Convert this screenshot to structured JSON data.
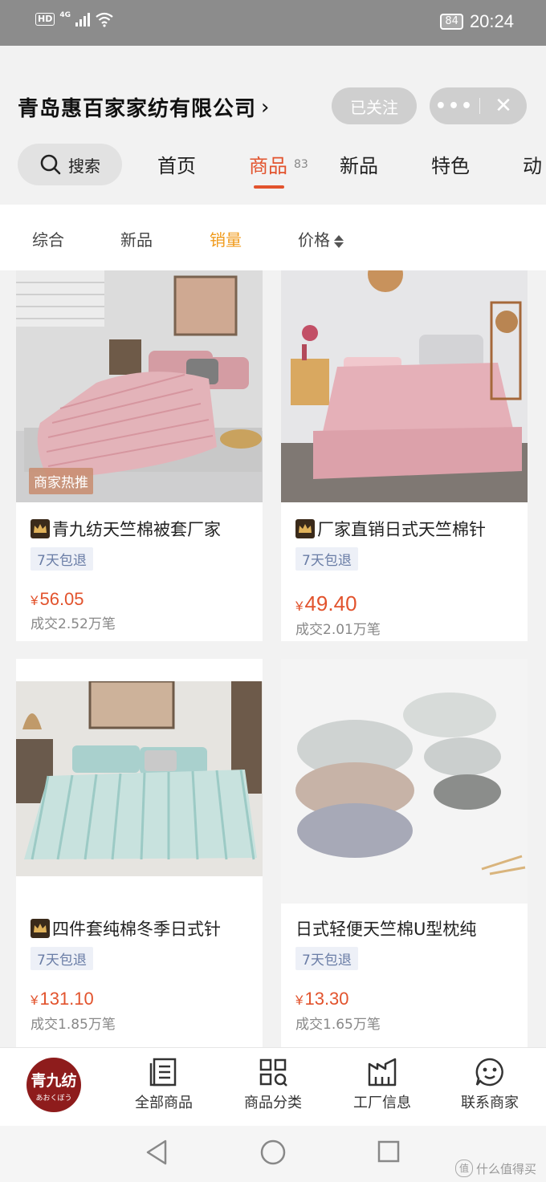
{
  "status_bar": {
    "hd": "HD",
    "network": "4G",
    "battery": "84",
    "time": "20:24"
  },
  "shop": {
    "name": "青岛惠百家家纺有限公司",
    "follow_label": "已关注",
    "more_icon": "more-dots-icon",
    "close_icon": "close-icon"
  },
  "tabs": {
    "search_label": "搜索",
    "items": [
      {
        "label": "首页"
      },
      {
        "label": "商品",
        "count": "83",
        "active": true
      },
      {
        "label": "新品"
      },
      {
        "label": "特色"
      },
      {
        "label": "动"
      }
    ]
  },
  "sort": {
    "items": [
      {
        "label": "综合"
      },
      {
        "label": "新品"
      },
      {
        "label": "销量",
        "active": true
      },
      {
        "label": "价格"
      }
    ]
  },
  "products": [
    {
      "title": "青九纺天竺棉被套厂家",
      "crown": true,
      "badge": "7天包退",
      "currency": "¥",
      "price": "56.05",
      "sold": "成交2.52万笔",
      "tag": "商家热推"
    },
    {
      "title": "厂家直销日式天竺棉针",
      "crown": true,
      "badge": "7天包退",
      "currency": "¥",
      "price": "49.40",
      "sold": "成交2.01万笔"
    },
    {
      "title": "四件套纯棉冬季日式针",
      "crown": true,
      "badge": "7天包退",
      "currency": "¥",
      "price": "131.10",
      "sold": "成交1.85万笔"
    },
    {
      "title": "日式轻便天竺棉U型枕纯",
      "crown": false,
      "badge": "7天包退",
      "currency": "¥",
      "price": "13.30",
      "sold": "成交1.65万笔"
    }
  ],
  "bottom_nav": {
    "logo_line1": "青九纺",
    "logo_line2": "あおくぼう",
    "items": [
      {
        "label": "全部商品",
        "icon": "document-list-icon"
      },
      {
        "label": "商品分类",
        "icon": "category-grid-icon"
      },
      {
        "label": "工厂信息",
        "icon": "factory-icon"
      },
      {
        "label": "联系商家",
        "icon": "chat-face-icon"
      }
    ]
  },
  "watermark": {
    "symbol": "值",
    "text": "什么值得买"
  },
  "colors": {
    "accent": "#e2532d",
    "sort_active": "#f09a1a",
    "badge_text": "#6a7da6",
    "logo_bg": "#8e1c1c"
  }
}
